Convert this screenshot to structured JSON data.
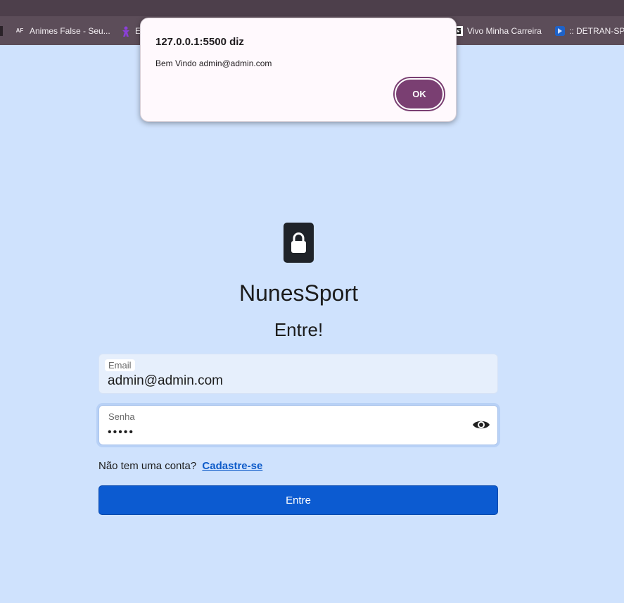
{
  "browser": {
    "bookmarks": [
      {
        "label": "Animes False - Seu...",
        "icon": "af-favicon"
      },
      {
        "label": "E",
        "icon": "purple-figure-favicon"
      },
      {
        "label": "Vivo Minha Carreira",
        "icon": "vivo-favicon"
      },
      {
        "label": ":: DETRAN-SP :",
        "icon": "detran-favicon"
      }
    ]
  },
  "alert": {
    "origin": "127.0.0.1:5500 diz",
    "message": "Bem Vindo admin@admin.com",
    "ok_label": "OK"
  },
  "login": {
    "brand": "NunesSport",
    "subtitle": "Entre!",
    "email": {
      "label": "Email",
      "value": "admin@admin.com"
    },
    "password": {
      "label": "Senha",
      "value": "•••••"
    },
    "signup_prompt": "Não tem uma conta?",
    "signup_link": "Cadastre-se",
    "submit_label": "Entre"
  },
  "colors": {
    "page_background": "#cfe2fd",
    "primary_button": "#0c5bd1",
    "alert_ok": "#7a3f72",
    "link": "#0d5bc9"
  }
}
